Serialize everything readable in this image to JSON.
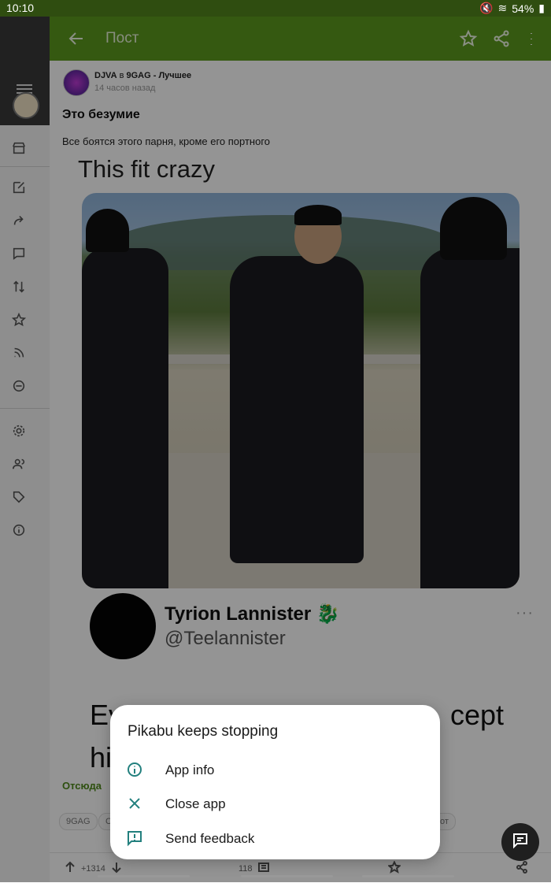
{
  "status_bar": {
    "time": "10:10",
    "battery": "54%"
  },
  "toolbar": {
    "title": "Пост"
  },
  "post": {
    "author": "DJVA",
    "in_word": "в",
    "community": "9GAG - Лучшее",
    "time_ago": "14 часов назад",
    "title": "Это безумие",
    "description": "Все боятся этого парня, кроме его портного",
    "meme_caption": "This fit crazy",
    "tweet_name": "Tyrion Lannister 🐉",
    "tweet_handle": "@Teelannister",
    "tweet_more": "···",
    "tweet_line1_start": "Eve",
    "tweet_line1_end": "cept",
    "tweet_line2": "his",
    "source_label": "Отсюда",
    "tags": [
      "9GAG",
      "С",
      "от"
    ],
    "rating": "+1314",
    "comments": "118"
  },
  "dialog": {
    "title": "Pikabu keeps stopping",
    "items": [
      {
        "label": "App info",
        "icon": "info-icon"
      },
      {
        "label": "Close app",
        "icon": "close-icon"
      },
      {
        "label": "Send feedback",
        "icon": "feedback-icon"
      }
    ]
  },
  "colors": {
    "toolbar": "#5c9a1e",
    "status_bar": "#2f4d10",
    "dialog_icon": "#23807e"
  }
}
